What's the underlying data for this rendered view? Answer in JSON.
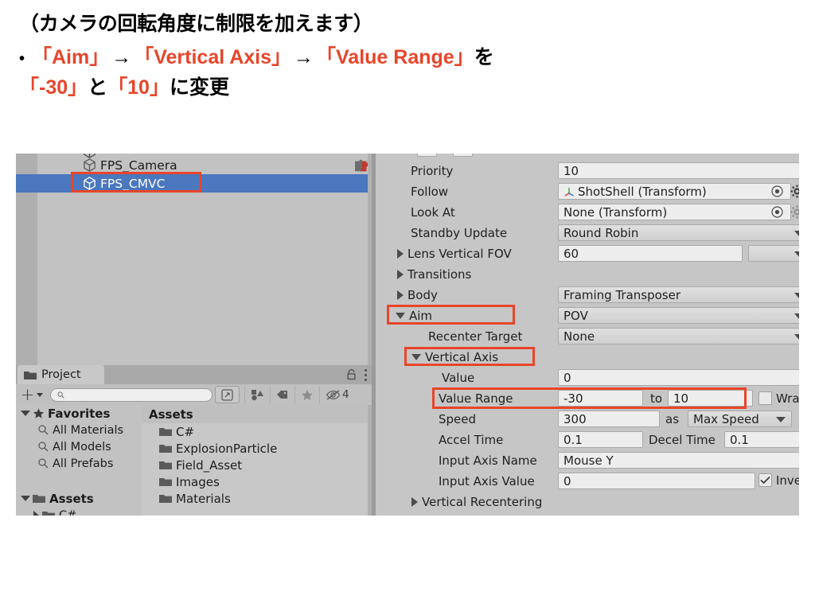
{
  "slide": {
    "line1": "（カメラの回転角度に制限を加えます）",
    "bullet": "•",
    "line2_a": "「Aim」",
    "arrow1": "→",
    "line2_b": "「Vertical Axis」",
    "arrow2": "→",
    "line2_c": "「Value Range」",
    "line2_d": "を",
    "line3_a": "「-30」",
    "line3_b": "と",
    "line3_c": "「10」",
    "line3_d": "に変更",
    "accent_color": "#E8452A"
  },
  "hierarchy": {
    "items": [
      {
        "label": "FPS_Camera",
        "selected": false
      },
      {
        "label": "FPS_CMVC",
        "selected": true
      }
    ],
    "selection_color": "#4A77BE"
  },
  "project": {
    "tab_label": "Project",
    "search_value": "",
    "hidden_count": "4",
    "tree": [
      {
        "label": "Favorites",
        "kind": "root-star"
      },
      {
        "label": "All Materials",
        "kind": "search"
      },
      {
        "label": "All Models",
        "kind": "search"
      },
      {
        "label": "All Prefabs",
        "kind": "search"
      },
      {
        "label": "Assets",
        "kind": "root-folder"
      },
      {
        "label": "C#",
        "kind": "folder-child"
      }
    ],
    "content_header": "Assets",
    "content_items": [
      "C#",
      "ExplosionParticle",
      "Field_Asset",
      "Images",
      "Materials"
    ]
  },
  "inspector": {
    "rows": {
      "priority": {
        "label": "Priority",
        "value": "10"
      },
      "follow": {
        "label": "Follow",
        "value": "ShotShell (Transform)"
      },
      "look_at": {
        "label": "Look At",
        "value": "None (Transform)"
      },
      "standby_update": {
        "label": "Standby Update",
        "value": "Round Robin"
      },
      "lens_vertical_fov": {
        "label": "Lens Vertical FOV",
        "value": "60",
        "preset": ""
      },
      "transitions": {
        "label": "Transitions"
      },
      "body": {
        "label": "Body",
        "value": "Framing Transposer"
      },
      "aim": {
        "label": "Aim",
        "value": "POV"
      },
      "recenter_target": {
        "label": "Recenter Target",
        "value": "None"
      },
      "vertical_axis": {
        "label": "Vertical Axis"
      },
      "value": {
        "label": "Value",
        "value": "0"
      },
      "value_range": {
        "label": "Value Range",
        "min": "-30",
        "to": "to",
        "max": "10",
        "wrap_label": "Wrap",
        "wrap_checked": false
      },
      "speed": {
        "label": "Speed",
        "value": "300",
        "as_label": "as",
        "mode": "Max Speed"
      },
      "accel_time": {
        "label": "Accel Time",
        "value": "0.1",
        "decel_label": "Decel Time",
        "decel_value": "0.1"
      },
      "input_axis_name": {
        "label": "Input Axis Name",
        "value": "Mouse Y"
      },
      "input_axis_value": {
        "label": "Input Axis Value",
        "value": "0",
        "invert_label": "Invert",
        "invert_checked": true
      },
      "vertical_recentering": {
        "label": "Vertical Recentering"
      }
    }
  }
}
